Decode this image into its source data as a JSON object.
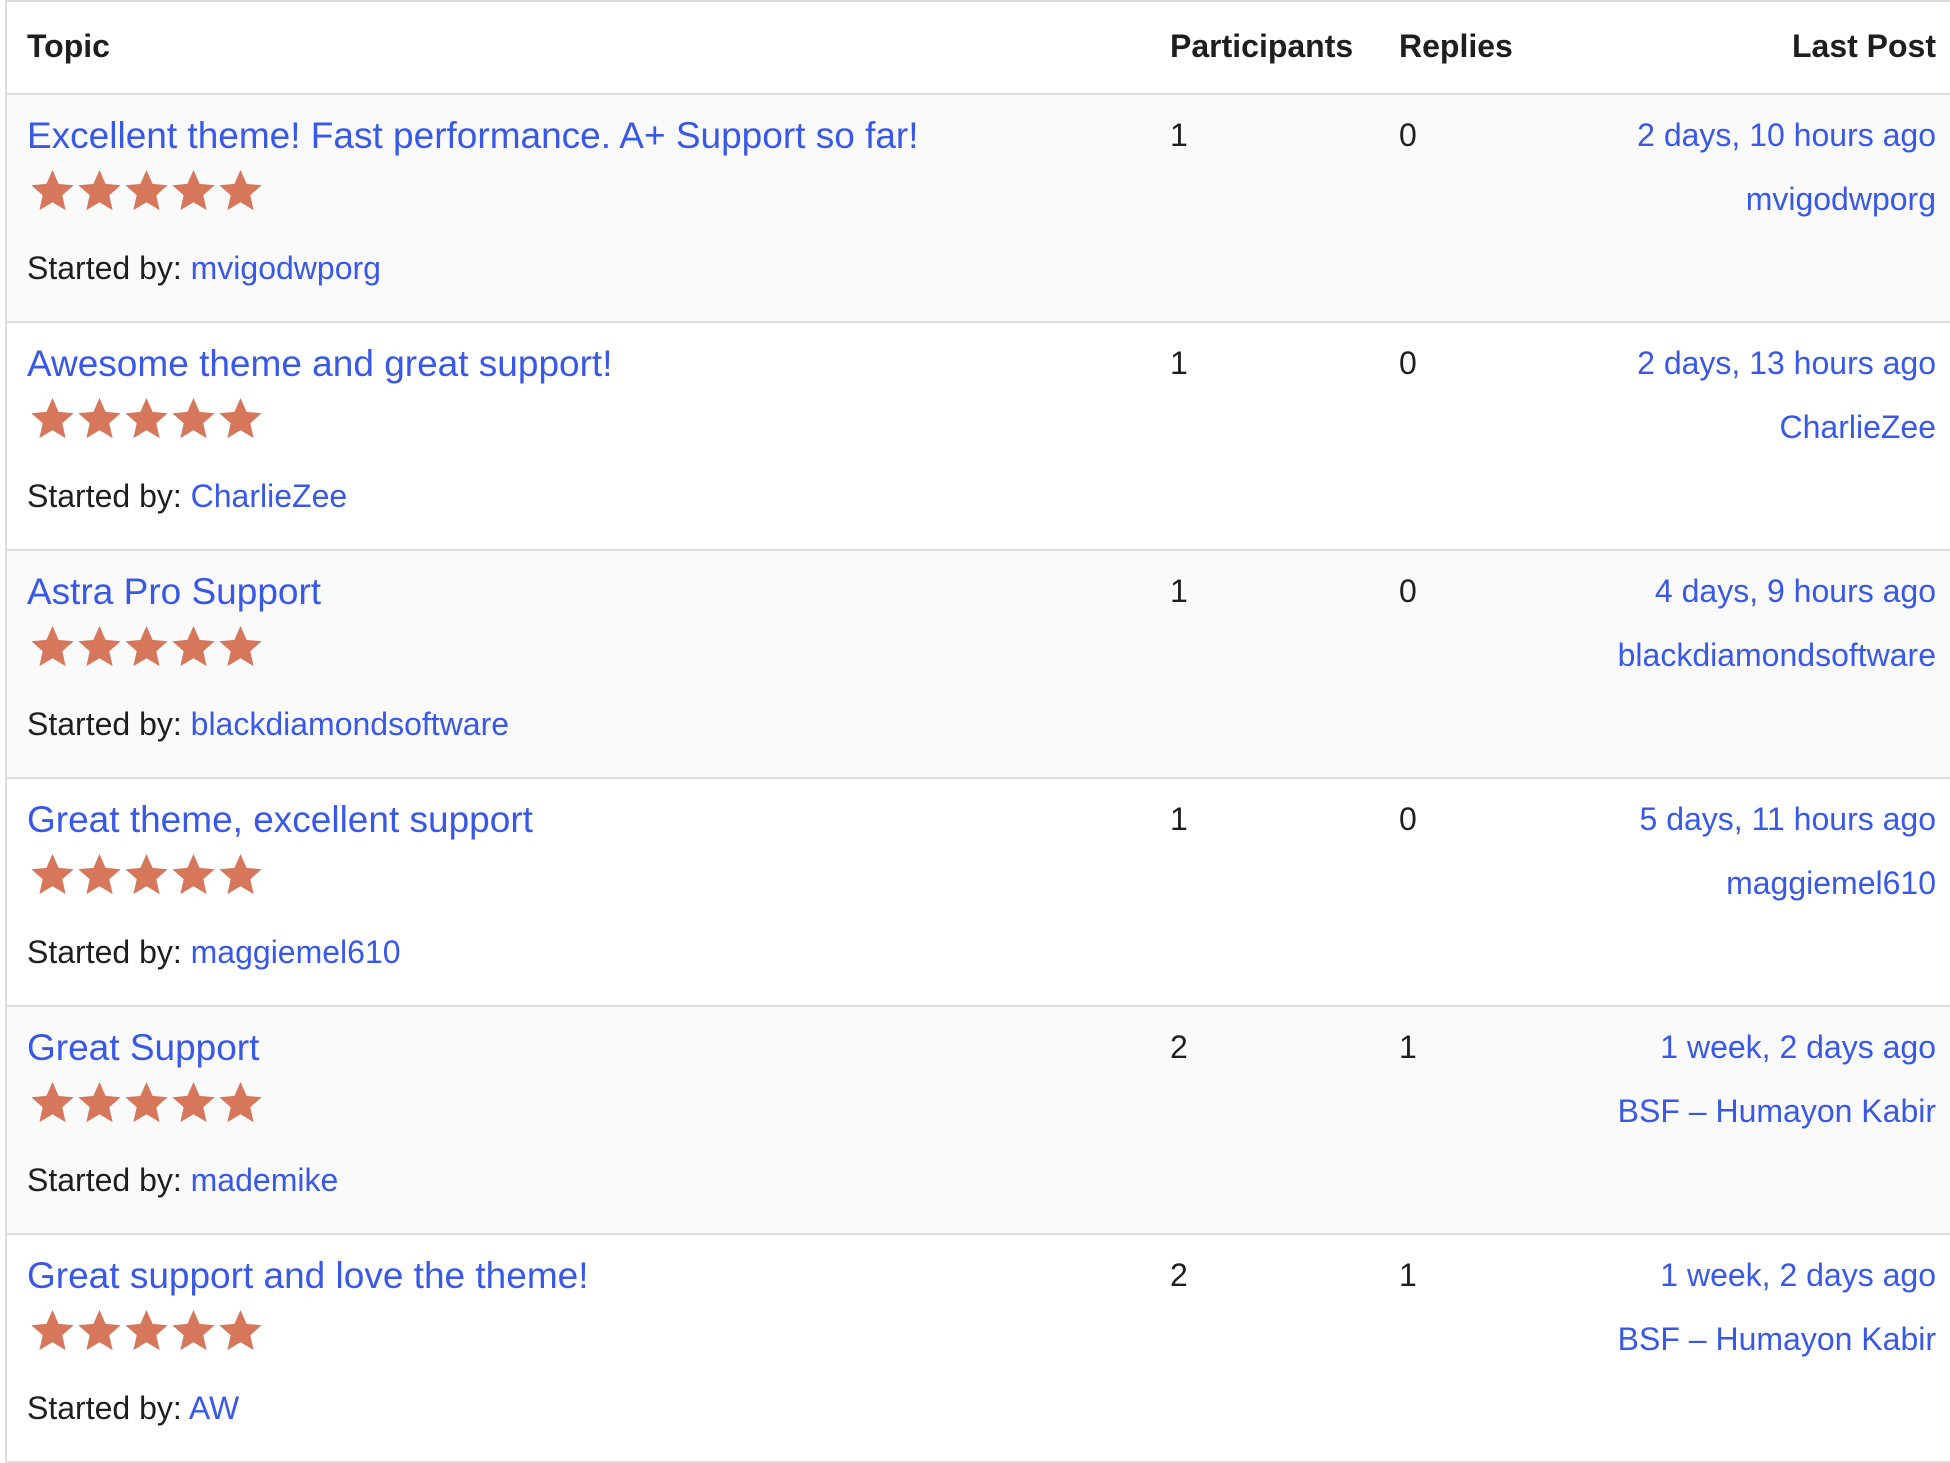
{
  "header": {
    "topic": "Topic",
    "participants": "Participants",
    "replies": "Replies",
    "last_post": "Last Post"
  },
  "colors": {
    "link": "#3858e9",
    "star": "#d6765a",
    "alt_row": "#fafafa"
  },
  "started_by_label": "Started by:",
  "rows": [
    {
      "title": "Excellent theme! Fast performance. A+ Support so far!",
      "rating": 5,
      "author": "mvigodwporg",
      "participants": "1",
      "replies": "0",
      "last_post_time": "2 days, 10 hours ago",
      "last_post_user": "mvigodwporg"
    },
    {
      "title": "Awesome theme and great support!",
      "rating": 5,
      "author": "CharlieZee",
      "participants": "1",
      "replies": "0",
      "last_post_time": "2 days, 13 hours ago",
      "last_post_user": "CharlieZee"
    },
    {
      "title": "Astra Pro Support",
      "rating": 5,
      "author": "blackdiamondsoftware",
      "participants": "1",
      "replies": "0",
      "last_post_time": "4 days, 9 hours ago",
      "last_post_user": "blackdiamondsoftware"
    },
    {
      "title": "Great theme, excellent support",
      "rating": 5,
      "author": "maggiemel610",
      "participants": "1",
      "replies": "0",
      "last_post_time": "5 days, 11 hours ago",
      "last_post_user": "maggiemel610"
    },
    {
      "title": "Great Support",
      "rating": 5,
      "author": "mademike",
      "participants": "2",
      "replies": "1",
      "last_post_time": "1 week, 2 days ago",
      "last_post_user": "BSF – Humayon Kabir"
    },
    {
      "title": "Great support and love the theme!",
      "rating": 5,
      "author": "AW",
      "participants": "2",
      "replies": "1",
      "last_post_time": "1 week, 2 days ago",
      "last_post_user": "BSF – Humayon Kabir"
    }
  ]
}
